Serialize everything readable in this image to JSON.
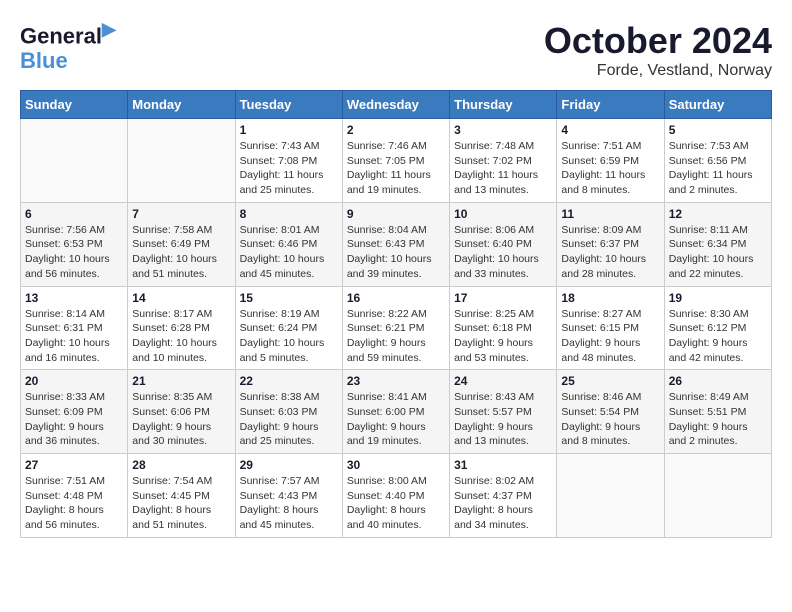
{
  "header": {
    "logo_line1": "General",
    "logo_line2": "Blue",
    "title": "October 2024",
    "subtitle": "Forde, Vestland, Norway"
  },
  "calendar": {
    "weekdays": [
      "Sunday",
      "Monday",
      "Tuesday",
      "Wednesday",
      "Thursday",
      "Friday",
      "Saturday"
    ],
    "weeks": [
      [
        {
          "day": "",
          "content": ""
        },
        {
          "day": "",
          "content": ""
        },
        {
          "day": "1",
          "content": "Sunrise: 7:43 AM\nSunset: 7:08 PM\nDaylight: 11 hours\nand 25 minutes."
        },
        {
          "day": "2",
          "content": "Sunrise: 7:46 AM\nSunset: 7:05 PM\nDaylight: 11 hours\nand 19 minutes."
        },
        {
          "day": "3",
          "content": "Sunrise: 7:48 AM\nSunset: 7:02 PM\nDaylight: 11 hours\nand 13 minutes."
        },
        {
          "day": "4",
          "content": "Sunrise: 7:51 AM\nSunset: 6:59 PM\nDaylight: 11 hours\nand 8 minutes."
        },
        {
          "day": "5",
          "content": "Sunrise: 7:53 AM\nSunset: 6:56 PM\nDaylight: 11 hours\nand 2 minutes."
        }
      ],
      [
        {
          "day": "6",
          "content": "Sunrise: 7:56 AM\nSunset: 6:53 PM\nDaylight: 10 hours\nand 56 minutes."
        },
        {
          "day": "7",
          "content": "Sunrise: 7:58 AM\nSunset: 6:49 PM\nDaylight: 10 hours\nand 51 minutes."
        },
        {
          "day": "8",
          "content": "Sunrise: 8:01 AM\nSunset: 6:46 PM\nDaylight: 10 hours\nand 45 minutes."
        },
        {
          "day": "9",
          "content": "Sunrise: 8:04 AM\nSunset: 6:43 PM\nDaylight: 10 hours\nand 39 minutes."
        },
        {
          "day": "10",
          "content": "Sunrise: 8:06 AM\nSunset: 6:40 PM\nDaylight: 10 hours\nand 33 minutes."
        },
        {
          "day": "11",
          "content": "Sunrise: 8:09 AM\nSunset: 6:37 PM\nDaylight: 10 hours\nand 28 minutes."
        },
        {
          "day": "12",
          "content": "Sunrise: 8:11 AM\nSunset: 6:34 PM\nDaylight: 10 hours\nand 22 minutes."
        }
      ],
      [
        {
          "day": "13",
          "content": "Sunrise: 8:14 AM\nSunset: 6:31 PM\nDaylight: 10 hours\nand 16 minutes."
        },
        {
          "day": "14",
          "content": "Sunrise: 8:17 AM\nSunset: 6:28 PM\nDaylight: 10 hours\nand 10 minutes."
        },
        {
          "day": "15",
          "content": "Sunrise: 8:19 AM\nSunset: 6:24 PM\nDaylight: 10 hours\nand 5 minutes."
        },
        {
          "day": "16",
          "content": "Sunrise: 8:22 AM\nSunset: 6:21 PM\nDaylight: 9 hours\nand 59 minutes."
        },
        {
          "day": "17",
          "content": "Sunrise: 8:25 AM\nSunset: 6:18 PM\nDaylight: 9 hours\nand 53 minutes."
        },
        {
          "day": "18",
          "content": "Sunrise: 8:27 AM\nSunset: 6:15 PM\nDaylight: 9 hours\nand 48 minutes."
        },
        {
          "day": "19",
          "content": "Sunrise: 8:30 AM\nSunset: 6:12 PM\nDaylight: 9 hours\nand 42 minutes."
        }
      ],
      [
        {
          "day": "20",
          "content": "Sunrise: 8:33 AM\nSunset: 6:09 PM\nDaylight: 9 hours\nand 36 minutes."
        },
        {
          "day": "21",
          "content": "Sunrise: 8:35 AM\nSunset: 6:06 PM\nDaylight: 9 hours\nand 30 minutes."
        },
        {
          "day": "22",
          "content": "Sunrise: 8:38 AM\nSunset: 6:03 PM\nDaylight: 9 hours\nand 25 minutes."
        },
        {
          "day": "23",
          "content": "Sunrise: 8:41 AM\nSunset: 6:00 PM\nDaylight: 9 hours\nand 19 minutes."
        },
        {
          "day": "24",
          "content": "Sunrise: 8:43 AM\nSunset: 5:57 PM\nDaylight: 9 hours\nand 13 minutes."
        },
        {
          "day": "25",
          "content": "Sunrise: 8:46 AM\nSunset: 5:54 PM\nDaylight: 9 hours\nand 8 minutes."
        },
        {
          "day": "26",
          "content": "Sunrise: 8:49 AM\nSunset: 5:51 PM\nDaylight: 9 hours\nand 2 minutes."
        }
      ],
      [
        {
          "day": "27",
          "content": "Sunrise: 7:51 AM\nSunset: 4:48 PM\nDaylight: 8 hours\nand 56 minutes."
        },
        {
          "day": "28",
          "content": "Sunrise: 7:54 AM\nSunset: 4:45 PM\nDaylight: 8 hours\nand 51 minutes."
        },
        {
          "day": "29",
          "content": "Sunrise: 7:57 AM\nSunset: 4:43 PM\nDaylight: 8 hours\nand 45 minutes."
        },
        {
          "day": "30",
          "content": "Sunrise: 8:00 AM\nSunset: 4:40 PM\nDaylight: 8 hours\nand 40 minutes."
        },
        {
          "day": "31",
          "content": "Sunrise: 8:02 AM\nSunset: 4:37 PM\nDaylight: 8 hours\nand 34 minutes."
        },
        {
          "day": "",
          "content": ""
        },
        {
          "day": "",
          "content": ""
        }
      ]
    ]
  }
}
